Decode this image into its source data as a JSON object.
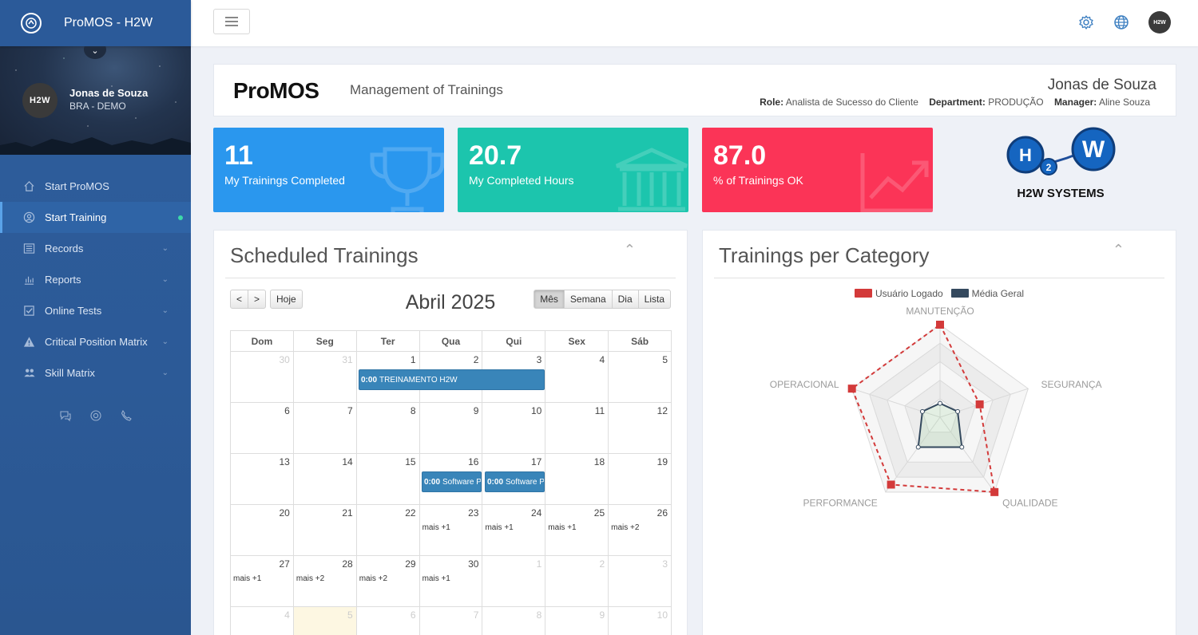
{
  "app": {
    "title": "ProMOS - H2W"
  },
  "user": {
    "avatar_text": "H2W",
    "name": "Jonas de Souza",
    "subtitle": "BRA - DEMO"
  },
  "menu": [
    {
      "label": "Start ProMOS",
      "icon": "home-icon",
      "expandable": false
    },
    {
      "label": "Start Training",
      "icon": "user-circle-icon",
      "active": true
    },
    {
      "label": "Records",
      "icon": "list-icon",
      "expandable": true
    },
    {
      "label": "Reports",
      "icon": "bar-chart-icon",
      "expandable": true
    },
    {
      "label": "Online Tests",
      "icon": "checkbox-icon",
      "expandable": true
    },
    {
      "label": "Critical Position Matrix",
      "icon": "warning-icon",
      "expandable": true
    },
    {
      "label": "Skill Matrix",
      "icon": "users-icon",
      "expandable": true
    }
  ],
  "topbar": {
    "avatar_text": "H2W"
  },
  "header": {
    "logo_text": "ProMOS",
    "subtitle": "Management of Trainings",
    "name": "Jonas de Souza",
    "role_label": "Role:",
    "role": "Analista de Sucesso do Cliente",
    "department_label": "Department:",
    "department": "PRODUÇÃO",
    "manager_label": "Manager:",
    "manager": "Aline Souza"
  },
  "stats": [
    {
      "value": "11",
      "label": "My Trainings Completed",
      "color": "#2a97ee",
      "icon": "trophy-icon"
    },
    {
      "value": "20.7",
      "label": "My Completed Hours",
      "color": "#1cc5ad",
      "icon": "bank-icon"
    },
    {
      "value": "87.0",
      "label": "% of Trainings OK",
      "color": "#fb3457",
      "icon": "trend-chart-icon"
    }
  ],
  "brand": {
    "h": "H",
    "two": "2",
    "w": "W",
    "caption": "H2W SYSTEMS"
  },
  "calendar_panel": {
    "title": "Scheduled Trainings",
    "prev": "<",
    "next": ">",
    "today": "Hoje",
    "month_title": "Abril 2025",
    "views": [
      "Mês",
      "Semana",
      "Dia",
      "Lista"
    ],
    "active_view": "Mês",
    "weekdays": [
      "Dom",
      "Seg",
      "Ter",
      "Qua",
      "Qui",
      "Sex",
      "Sáb"
    ],
    "weeks": [
      [
        "30",
        "31",
        "1",
        "2",
        "3",
        "4",
        "5"
      ],
      [
        "6",
        "7",
        "8",
        "9",
        "10",
        "11",
        "12"
      ],
      [
        "13",
        "14",
        "15",
        "16",
        "17",
        "18",
        "19"
      ],
      [
        "20",
        "21",
        "22",
        "23",
        "24",
        "25",
        "26"
      ],
      [
        "27",
        "28",
        "29",
        "30",
        "1",
        "2",
        "3"
      ],
      [
        "4",
        "5",
        "6",
        "7",
        "8",
        "9",
        "10"
      ]
    ],
    "events": [
      {
        "time": "0:00",
        "title": "TREINAMENTO H2W"
      },
      {
        "time": "0:00",
        "title": "Software P"
      },
      {
        "time": "0:00",
        "title": "Software P"
      }
    ],
    "more": {
      "w3d3": "mais +1",
      "w3d4": "mais +1",
      "w3d5": "mais +1",
      "w3d6": "mais +2",
      "w4d0": "mais +1",
      "w4d1": "mais +2",
      "w4d2": "mais +2",
      "w4d3": "mais +1"
    }
  },
  "radar_panel": {
    "title": "Trainings per Category",
    "legend": [
      {
        "name": "Usuário Logado",
        "color": "#d33a3a"
      },
      {
        "name": "Média Geral",
        "color": "#34495e"
      }
    ]
  },
  "chart_data": {
    "type": "radar",
    "categories": [
      "MANUTENÇÃO",
      "SEGURANÇA",
      "QUALIDADE",
      "PERFORMANCE",
      "OPERACIONAL"
    ],
    "series": [
      {
        "name": "Usuário Logado",
        "values": [
          100,
          45,
          100,
          90,
          100
        ]
      },
      {
        "name": "Média Geral",
        "values": [
          15,
          20,
          40,
          40,
          20
        ]
      }
    ],
    "max": 100
  }
}
